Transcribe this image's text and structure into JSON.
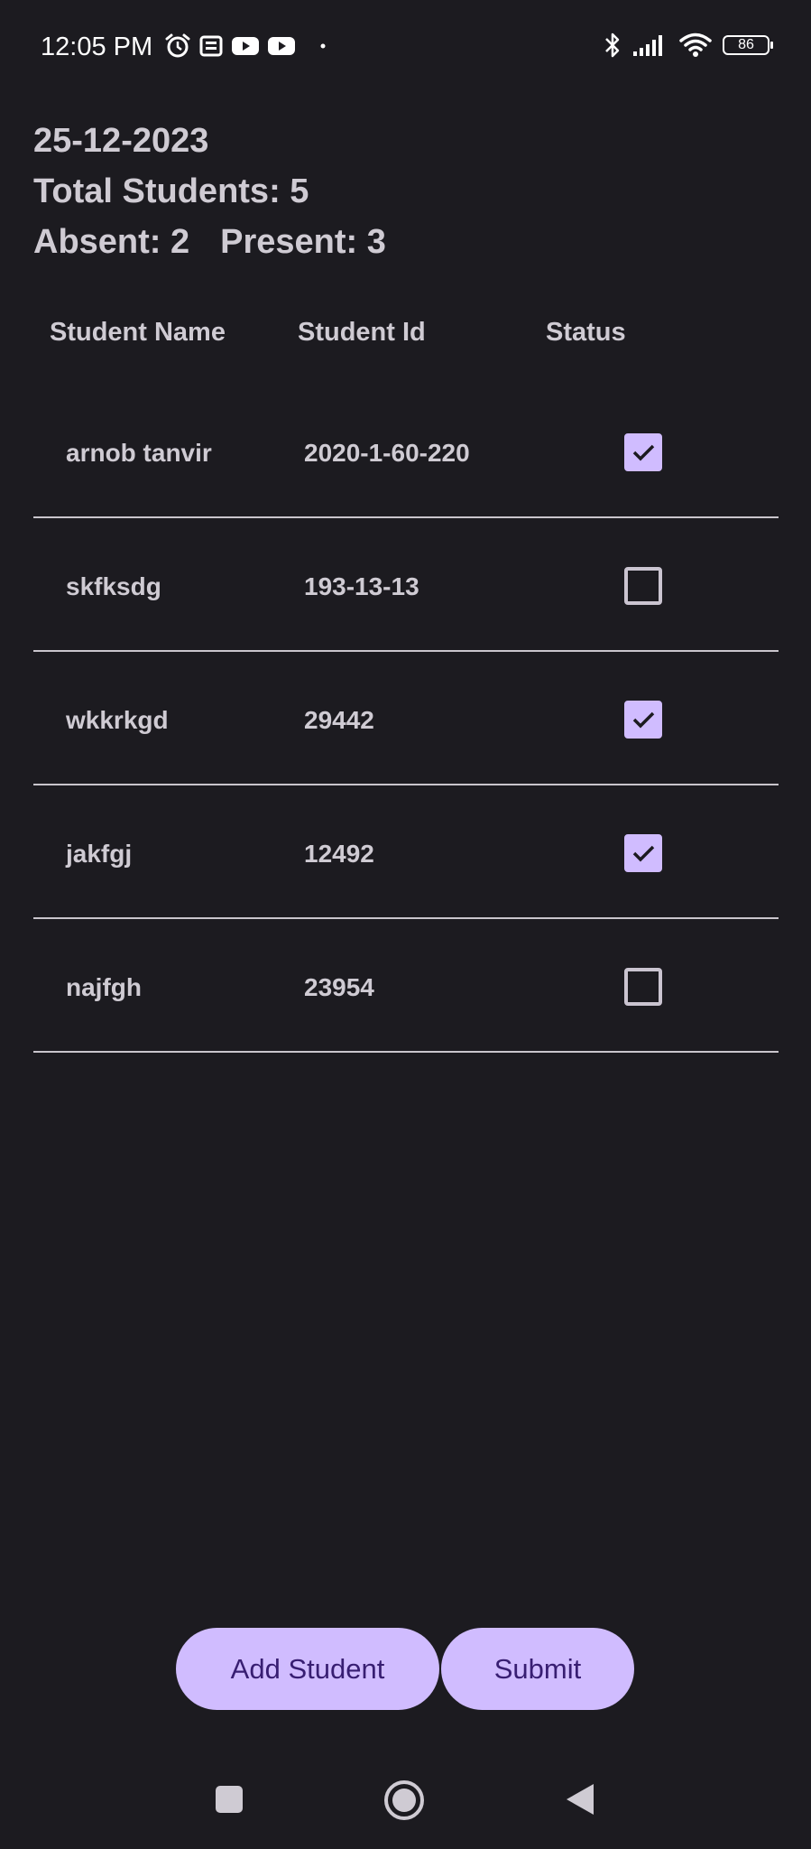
{
  "status_bar": {
    "time": "12:05 PM",
    "left_icons": [
      "alarm-icon",
      "news-icon",
      "youtube-icon",
      "youtube-icon",
      "dot-icon"
    ],
    "right_icons": [
      "bluetooth-icon",
      "signal-icon",
      "wifi-icon"
    ],
    "battery": "86"
  },
  "header": {
    "date": "25-12-2023",
    "total_label": "Total Students: 5",
    "absent_label": "Absent: 2",
    "present_label": "Present: 3"
  },
  "table": {
    "columns": [
      "Student Name",
      "Student Id",
      "Status"
    ],
    "rows": [
      {
        "name": "arnob tanvir",
        "id": "2020-1-60-220",
        "present": true
      },
      {
        "name": "skfksdg",
        "id": "193-13-13",
        "present": false
      },
      {
        "name": "wkkrkgd",
        "id": "29442",
        "present": true
      },
      {
        "name": "jakfgj",
        "id": "12492",
        "present": true
      },
      {
        "name": "najfgh",
        "id": "23954",
        "present": false
      }
    ]
  },
  "actions": {
    "add_label": "Add Student",
    "submit_label": "Submit"
  },
  "colors": {
    "background": "#1c1b20",
    "accent": "#d0bcff",
    "on_accent": "#381e72",
    "text": "#cfcbd3"
  },
  "nav": {
    "icons": [
      "recents-square-icon",
      "home-circle-icon",
      "back-triangle-icon"
    ]
  }
}
